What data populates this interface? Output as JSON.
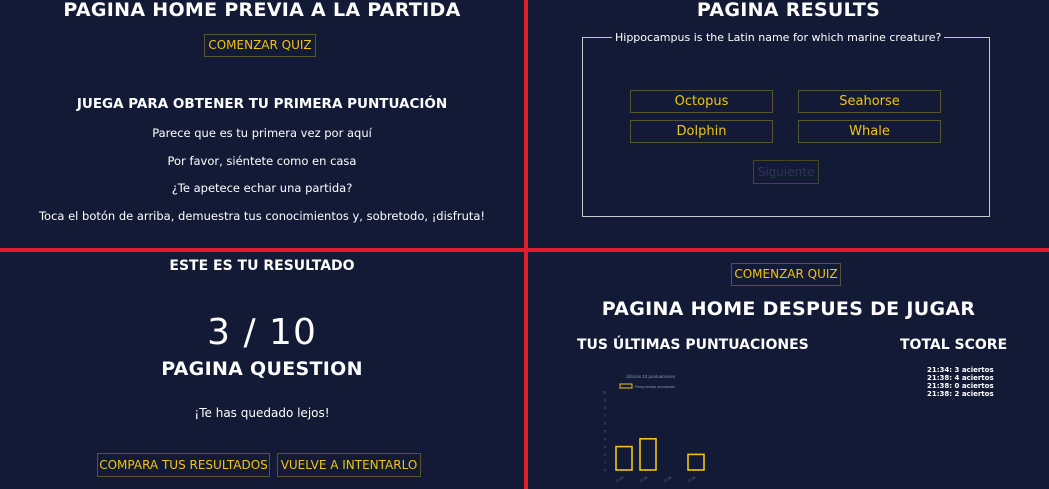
{
  "home_before": {
    "title": "PAGINA HOME PREVIA A LA PARTIDA",
    "start_button": "COMENZAR QUIZ",
    "subtitle": "JUEGA PARA OBTENER TU PRIMERA PUNTUACIÓN",
    "lines": [
      "Parece que es tu primera vez por aquí",
      "Por favor, siéntete como en casa",
      "¿Te apetece echar una partida?",
      "Toca el botón de arriba, demuestra tus conocimientos y, sobretodo, ¡disfruta!"
    ]
  },
  "results_page": {
    "title": "PAGINA RESULTS",
    "question": "Hippocampus is the Latin name for which marine creature?",
    "answers": [
      "Octopus",
      "Seahorse",
      "Dolphin",
      "Whale"
    ],
    "next_button": "Siguiente"
  },
  "question_page": {
    "heading": "ESTE ES TU RESULTADO",
    "score": "3 / 10",
    "title": "PAGINA QUESTION",
    "message": "¡Te has quedado lejos!",
    "compare_button": "COMPARA TUS RESULTADOS",
    "retry_button": "VUELVE A INTENTARLO"
  },
  "home_after": {
    "start_button": "COMENZAR QUIZ",
    "title": "PAGINA HOME DESPUES DE JUGAR",
    "last_scores_heading": "TUS ÚLTIMAS PUNTUACIONES",
    "total_score_heading": "TOTAL SCORE",
    "score_list": [
      "21:34: 3 aciertos",
      "21:38: 4 aciertos",
      "21:38: 0 aciertos",
      "21:38: 2 aciertos"
    ]
  },
  "chart_data": {
    "type": "bar",
    "title": "Últimas 10 puntuaciones",
    "series": [
      {
        "name": "Respuestas acertadas",
        "values": [
          3,
          4,
          0,
          2
        ]
      }
    ],
    "categories": [
      "21:34",
      "21:38",
      "21:38",
      "21:38"
    ],
    "ylim": [
      0,
      10
    ],
    "grid": false,
    "legend": "top",
    "colors": {
      "bar": "#f1c40f"
    }
  },
  "colors": {
    "background": "#131a35",
    "accent": "#f1c40f",
    "divider": "#e01e2b"
  }
}
